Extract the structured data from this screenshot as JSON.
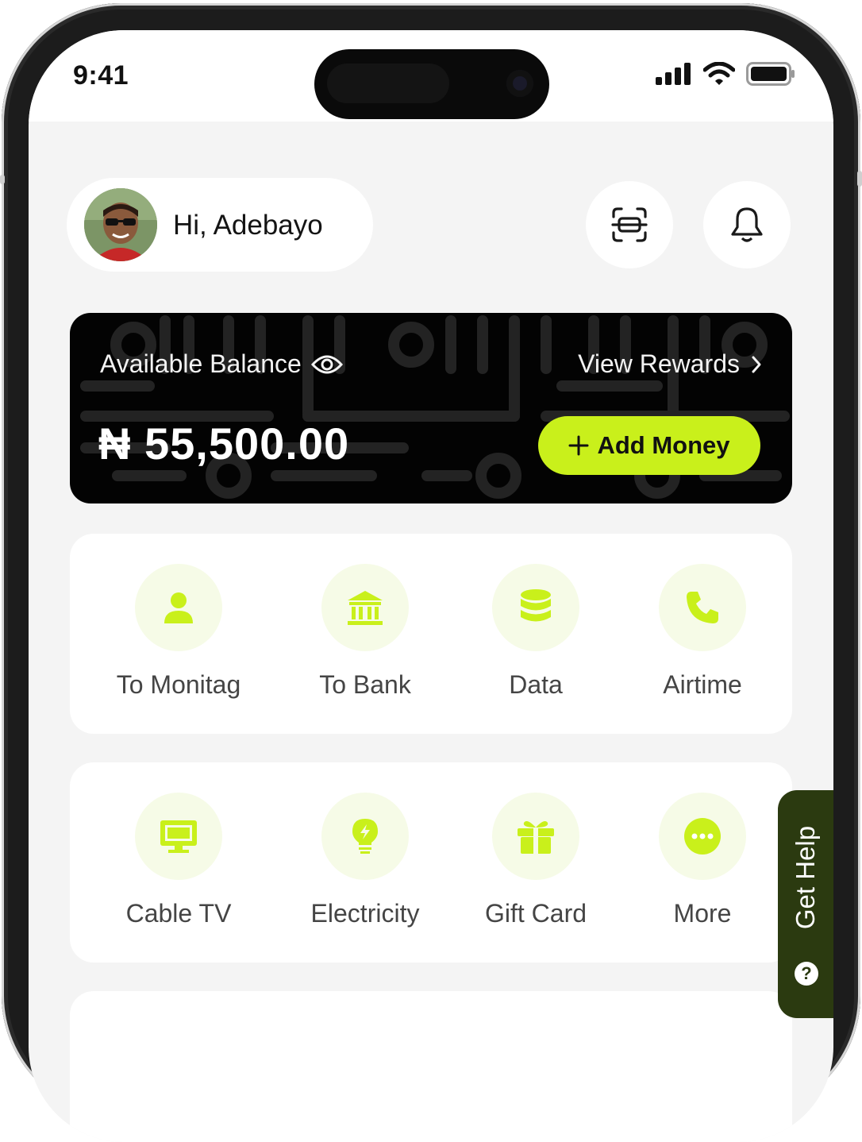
{
  "status_bar": {
    "time": "9:41"
  },
  "header": {
    "greeting": "Hi, Adebayo",
    "scan_icon": "scan-icon",
    "bell_icon": "bell-icon"
  },
  "balance": {
    "label": "Available Balance",
    "amount": "₦ 55,500.00",
    "rewards_link": "View Rewards",
    "add_money": "Add Money"
  },
  "services_row1": [
    {
      "label": "To Monitag",
      "icon": "person-icon"
    },
    {
      "label": "To Bank",
      "icon": "bank-icon"
    },
    {
      "label": "Data",
      "icon": "database-icon"
    },
    {
      "label": "Airtime",
      "icon": "phone-icon"
    }
  ],
  "services_row2": [
    {
      "label": "Cable TV",
      "icon": "tv-icon"
    },
    {
      "label": "Electricity",
      "icon": "bulb-icon"
    },
    {
      "label": "Gift Card",
      "icon": "gift-icon"
    },
    {
      "label": "More",
      "icon": "more-icon"
    }
  ],
  "help": {
    "label": "Get Help",
    "q": "?"
  },
  "colors": {
    "accent": "#C9F01B",
    "dark": "#030303",
    "help_bg": "#2B3A10",
    "icon_bg": "#F6FBE7"
  }
}
